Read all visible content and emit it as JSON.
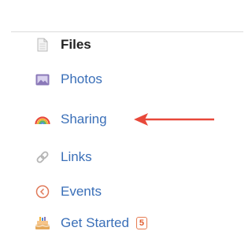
{
  "sidebar": {
    "items": [
      {
        "label": "Files",
        "icon": "file-icon",
        "active": true
      },
      {
        "label": "Photos",
        "icon": "photo-icon",
        "active": false
      },
      {
        "label": "Sharing",
        "icon": "rainbow-icon",
        "active": false
      },
      {
        "label": "Links",
        "icon": "link-icon",
        "active": false
      },
      {
        "label": "Events",
        "icon": "events-clock-icon",
        "active": false
      },
      {
        "label": "Get Started",
        "icon": "cake-icon",
        "active": false,
        "badge": "5"
      }
    ]
  },
  "annotation": {
    "arrow_color": "#e8483a",
    "points_to": "Sharing"
  },
  "colors": {
    "link": "#3a6fb8",
    "active_text": "#222222",
    "badge": "#e05a2b"
  }
}
